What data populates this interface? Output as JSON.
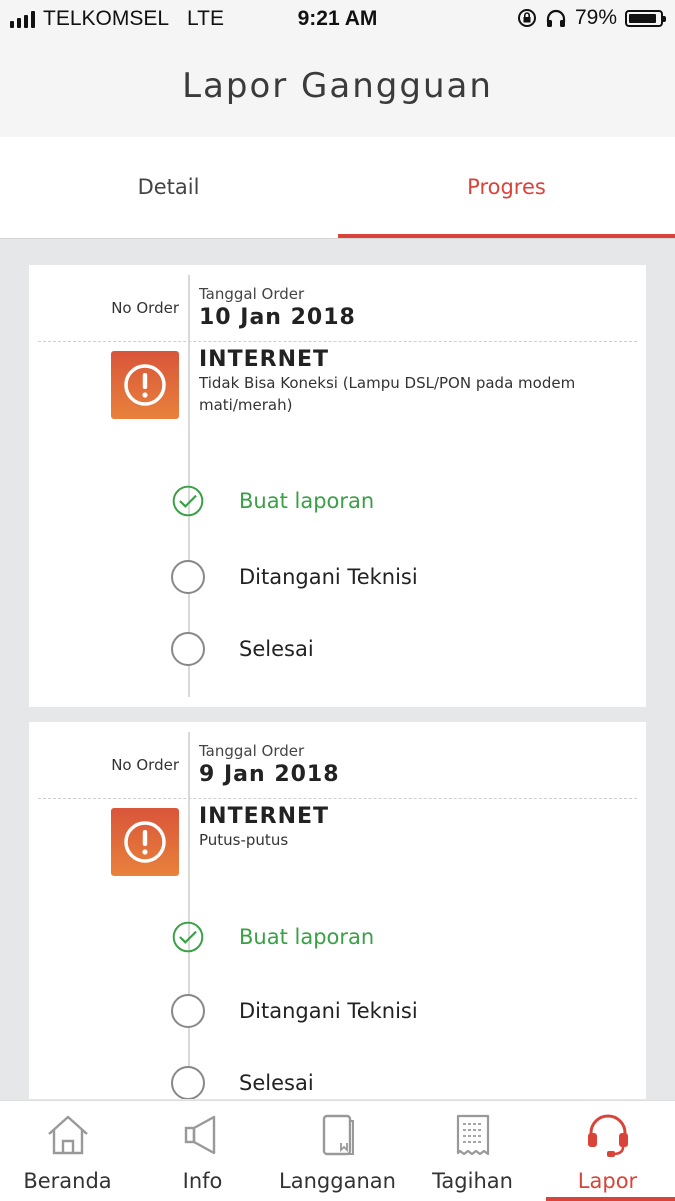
{
  "status_bar": {
    "carrier": "TELKOMSEL",
    "network": "LTE",
    "time": "9:21 AM",
    "battery": "79%",
    "battery_level": 0.79,
    "icons": [
      "signal-icon",
      "orientation-lock-icon",
      "headphones-icon",
      "battery-icon"
    ]
  },
  "header": {
    "title": "Lapor Gangguan"
  },
  "tabs": [
    {
      "label": "Detail",
      "active": false
    },
    {
      "label": "Progres",
      "active": true
    }
  ],
  "colors": {
    "accent": "#d9443a",
    "done_green": "#3aa046",
    "warning_gradient_top": "#d9553a",
    "warning_gradient_bottom": "#e8823c"
  },
  "orders": [
    {
      "no_order_label": "No Order",
      "date_caption": "Tanggal Order",
      "date": "10 Jan 2018",
      "service": "INTERNET",
      "description": "Tidak Bisa Koneksi (Lampu DSL/PON pada modem mati/merah)",
      "icon": "warning-icon",
      "steps": [
        {
          "label": "Buat laporan",
          "done": true
        },
        {
          "label": "Ditangani Teknisi",
          "done": false
        },
        {
          "label": "Selesai",
          "done": false
        }
      ]
    },
    {
      "no_order_label": "No Order",
      "date_caption": "Tanggal Order",
      "date": "9 Jan 2018",
      "service": "INTERNET",
      "description": "Putus-putus",
      "icon": "warning-icon",
      "steps": [
        {
          "label": "Buat laporan",
          "done": true
        },
        {
          "label": "Ditangani Teknisi",
          "done": false
        },
        {
          "label": "Selesai",
          "done": false
        }
      ]
    }
  ],
  "bottom_nav": [
    {
      "label": "Beranda",
      "icon": "home-icon",
      "active": false
    },
    {
      "label": "Info",
      "icon": "megaphone-icon",
      "active": false
    },
    {
      "label": "Langganan",
      "icon": "book-icon",
      "active": false
    },
    {
      "label": "Tagihan",
      "icon": "receipt-icon",
      "active": false
    },
    {
      "label": "Lapor",
      "icon": "headset-icon",
      "active": true
    }
  ]
}
